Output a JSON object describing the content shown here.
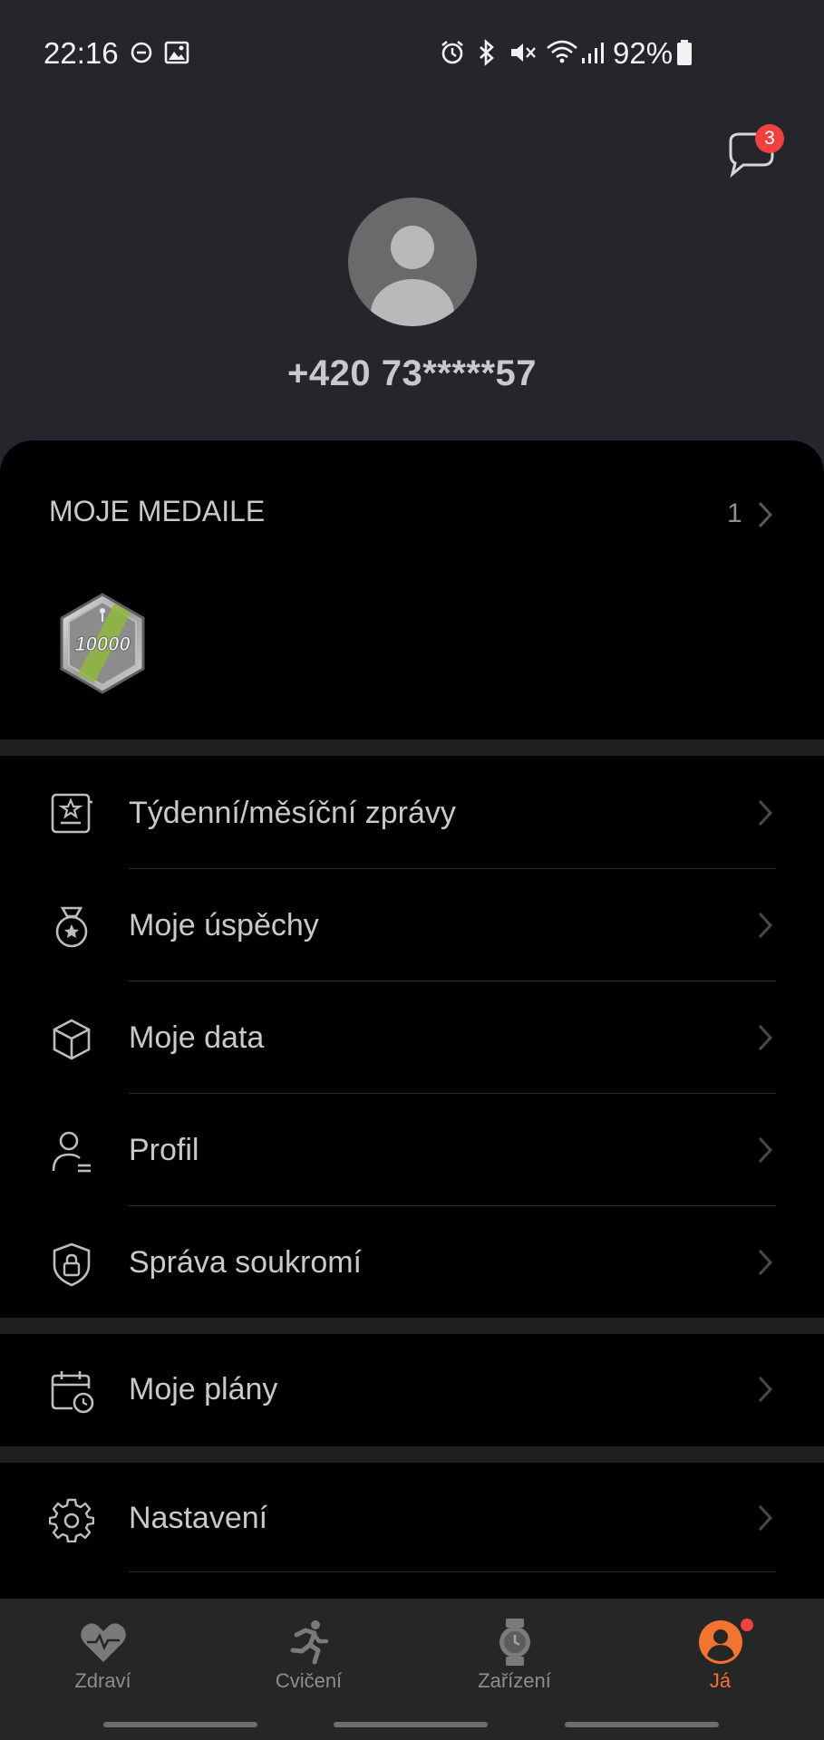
{
  "status_bar": {
    "time": "22:16",
    "battery": "92%",
    "icons": [
      "do-not-disturb-icon",
      "gallery-icon",
      "alarm-icon",
      "bluetooth-icon",
      "mute-icon",
      "wifi-icon",
      "signal-icon",
      "battery-icon"
    ]
  },
  "header": {
    "messages_badge": "3",
    "phone": "+420 73*****57"
  },
  "medals": {
    "title": "MOJE MEDAILE",
    "count": "1",
    "medal_text": "10000"
  },
  "menu_group_1": [
    {
      "label": "Týdenní/měsíční zprávy",
      "icon": "report-icon"
    },
    {
      "label": "Moje úspěchy",
      "icon": "medal-icon"
    },
    {
      "label": "Moje data",
      "icon": "cube-icon"
    },
    {
      "label": "Profil",
      "icon": "profile-icon"
    },
    {
      "label": "Správa soukromí",
      "icon": "privacy-shield-icon"
    }
  ],
  "menu_group_2": [
    {
      "label": "Moje plány",
      "icon": "calendar-clock-icon"
    }
  ],
  "menu_group_3": [
    {
      "label": "Nastavení",
      "icon": "gear-icon"
    }
  ],
  "bottom_nav": {
    "items": [
      {
        "label": "Zdraví",
        "icon": "heart-icon",
        "active": false
      },
      {
        "label": "Cvičení",
        "icon": "running-icon",
        "active": false
      },
      {
        "label": "Zařízení",
        "icon": "watch-icon",
        "active": false
      },
      {
        "label": "Já",
        "icon": "me-icon",
        "active": true
      }
    ]
  },
  "colors": {
    "header_bg": "#24262c",
    "accent": "#f27430",
    "badge": "#f04141",
    "background": "#000000"
  }
}
